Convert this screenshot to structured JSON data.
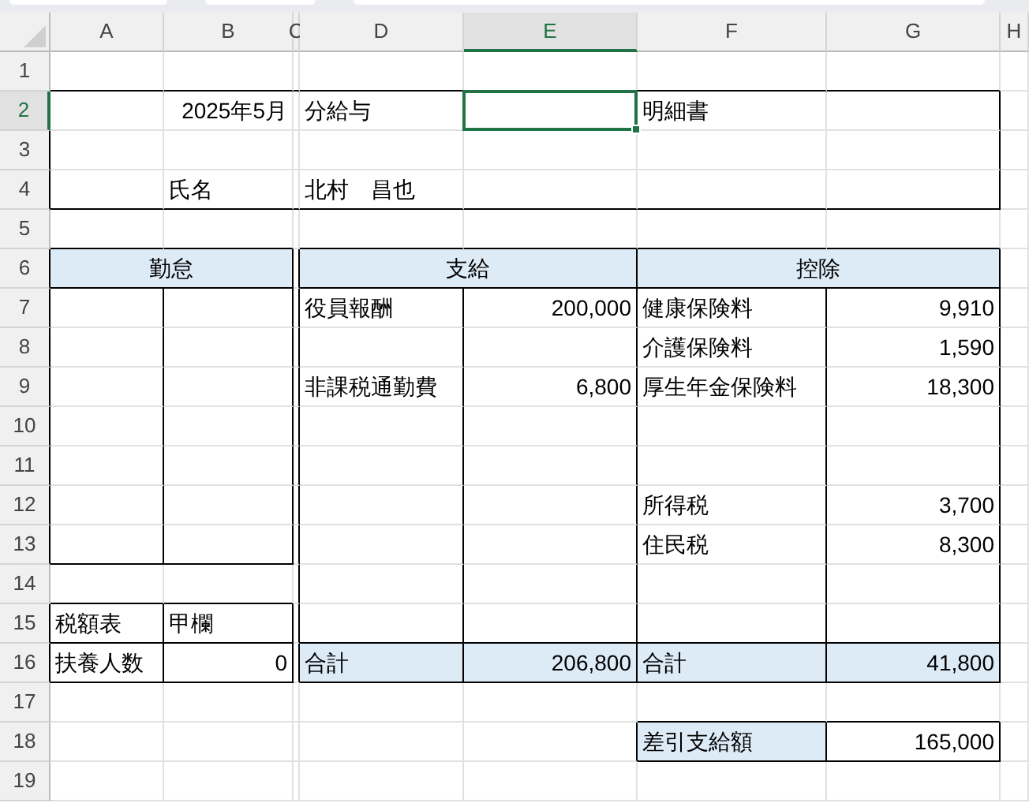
{
  "columns": [
    {
      "label": "A",
      "selected": false
    },
    {
      "label": "B",
      "selected": false
    },
    {
      "label": "C",
      "selected": false
    },
    {
      "label": "D",
      "selected": false
    },
    {
      "label": "E",
      "selected": true
    },
    {
      "label": "F",
      "selected": false
    },
    {
      "label": "G",
      "selected": false
    },
    {
      "label": "H",
      "selected": false
    }
  ],
  "rows": [
    {
      "label": "1",
      "selected": false
    },
    {
      "label": "2",
      "selected": true
    },
    {
      "label": "3",
      "selected": false
    },
    {
      "label": "4",
      "selected": false
    },
    {
      "label": "5",
      "selected": false
    },
    {
      "label": "6",
      "selected": false
    },
    {
      "label": "7",
      "selected": false
    },
    {
      "label": "8",
      "selected": false
    },
    {
      "label": "9",
      "selected": false
    },
    {
      "label": "10",
      "selected": false
    },
    {
      "label": "11",
      "selected": false
    },
    {
      "label": "12",
      "selected": false
    },
    {
      "label": "13",
      "selected": false
    },
    {
      "label": "14",
      "selected": false
    },
    {
      "label": "15",
      "selected": false
    },
    {
      "label": "16",
      "selected": false
    },
    {
      "label": "17",
      "selected": false
    },
    {
      "label": "18",
      "selected": false
    },
    {
      "label": "19",
      "selected": false
    }
  ],
  "header": {
    "period": "2025年5月",
    "title_start": "分給与",
    "title_end": "明細書",
    "name_label": "氏名",
    "name": "北村　昌也"
  },
  "attendance": {
    "title": "勤怠"
  },
  "payments": {
    "title": "支給",
    "items": [
      {
        "label": "役員報酬",
        "amount": "200,000"
      },
      {
        "label": "非課税通勤費",
        "amount": "6,800"
      }
    ],
    "total_label": "合計",
    "total": "206,800"
  },
  "deductions": {
    "title": "控除",
    "items": [
      {
        "label": "健康保険料",
        "amount": "9,910"
      },
      {
        "label": "介護保険料",
        "amount": "1,590"
      },
      {
        "label": "厚生年金保険料",
        "amount": "18,300"
      },
      {
        "label": "所得税",
        "amount": "3,700"
      },
      {
        "label": "住民税",
        "amount": "8,300"
      }
    ],
    "total_label": "合計",
    "total": "41,800"
  },
  "tax": {
    "table_label": "税額表",
    "table_value": "甲欄",
    "dependents_label": "扶養人数",
    "dependents": "0"
  },
  "net_pay": {
    "label": "差引支給額",
    "amount": "165,000"
  }
}
